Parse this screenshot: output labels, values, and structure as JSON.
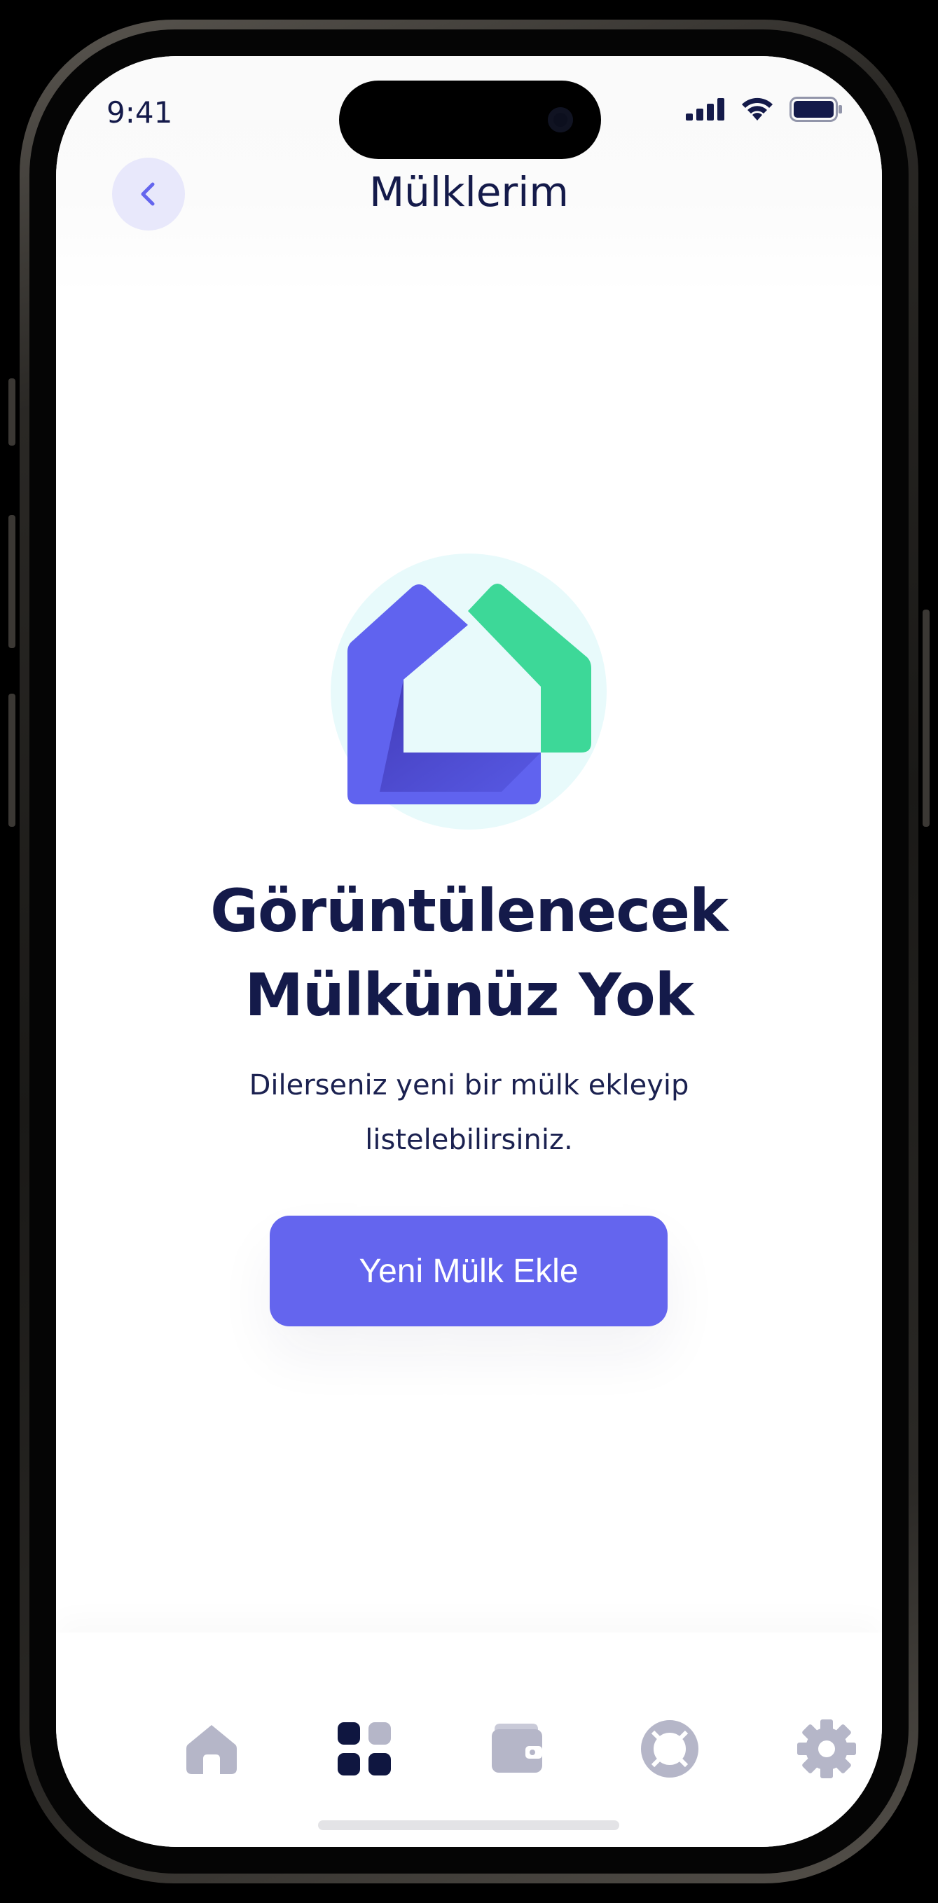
{
  "status_bar": {
    "time": "9:41"
  },
  "header": {
    "title": "Mülklerim"
  },
  "empty_state": {
    "title_line1": "Görüntülenecek",
    "title_line2": "Mülkünüz Yok",
    "description_line1": "Dilerseniz yeni bir mülk ekleyip",
    "description_line2": "listelebilirsiniz.",
    "button_label": "Yeni Mülk Ekle"
  },
  "tab_bar": {
    "items": [
      {
        "icon": "home-icon",
        "active": false
      },
      {
        "icon": "grid-icon",
        "active": true
      },
      {
        "icon": "wallet-icon",
        "active": false
      },
      {
        "icon": "lifebuoy-icon",
        "active": false
      },
      {
        "icon": "gear-icon",
        "active": false
      }
    ]
  },
  "colors": {
    "primary": "#6465ee",
    "text_dark": "#141a4a",
    "icon_inactive": "#b5b6c8",
    "icon_active": "#0f1640",
    "logo_green": "#3dd898",
    "logo_bg": "#e8fafb"
  }
}
